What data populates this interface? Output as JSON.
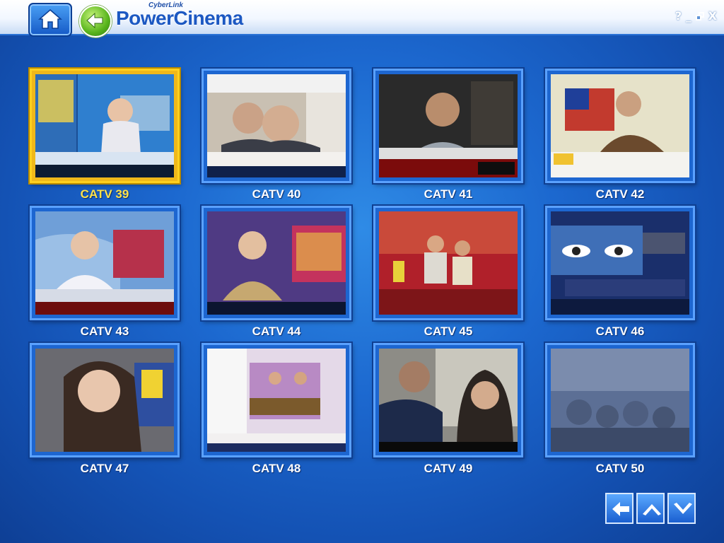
{
  "brand": {
    "small": "CyberLink",
    "name": "PowerCinema"
  },
  "window_controls": {
    "help": "?",
    "minimize": "_",
    "close": "X"
  },
  "icons": {
    "home": "home-icon",
    "back": "back-arrow-icon",
    "restore": "restore-icon",
    "prev_page": "left-arrow-icon",
    "scroll_up": "chevron-up-icon",
    "scroll_down": "chevron-down-icon"
  },
  "colors": {
    "selected_border": "#ffd01e",
    "selected_caption": "#ffe24a",
    "tile_border": "#5aa1ff"
  },
  "channels": [
    {
      "label": "CATV 39",
      "selected": true
    },
    {
      "label": "CATV 40",
      "selected": false
    },
    {
      "label": "CATV 41",
      "selected": false
    },
    {
      "label": "CATV 42",
      "selected": false
    },
    {
      "label": "CATV 43",
      "selected": false
    },
    {
      "label": "CATV 44",
      "selected": false
    },
    {
      "label": "CATV 45",
      "selected": false
    },
    {
      "label": "CATV 46",
      "selected": false
    },
    {
      "label": "CATV 47",
      "selected": false
    },
    {
      "label": "CATV 48",
      "selected": false
    },
    {
      "label": "CATV 49",
      "selected": false
    },
    {
      "label": "CATV 50",
      "selected": false
    }
  ]
}
